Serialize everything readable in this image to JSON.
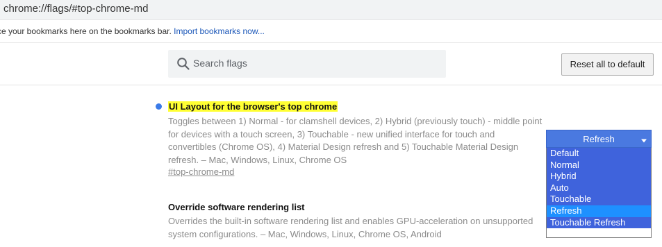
{
  "omnibox": {
    "url": "chrome://flags/#top-chrome-md"
  },
  "bookmarks_bar": {
    "text": "ce your bookmarks here on the bookmarks bar.",
    "import_link": "Import bookmarks now..."
  },
  "header": {
    "search_placeholder": "Search flags",
    "reset_button": "Reset all to default"
  },
  "experiments": [
    {
      "title": "UI Layout for the browser's top chrome",
      "description": "Toggles between 1) Normal - for clamshell devices, 2) Hybrid (previously touch) - middle point for devices with a touch screen, 3) Touchable - new unified interface for touch and convertibles (Chrome OS), 4) Material Design refresh and 5) Touchable Material Design refresh. – Mac, Windows, Linux, Chrome OS",
      "anchor": "#top-chrome-md",
      "select": {
        "value": "Refresh",
        "options": [
          "Default",
          "Normal",
          "Hybrid",
          "Auto",
          "Touchable",
          "Refresh",
          "Touchable Refresh"
        ],
        "selected_option": "Refresh"
      }
    },
    {
      "title": "Override software rendering list",
      "description": "Overrides the built-in software rendering list and enables GPU-acceleration on unsupported system configurations. – Mac, Windows, Linux, Chrome OS, Android"
    }
  ],
  "icons": {
    "search": "search-icon",
    "caret": "chevron-down-icon"
  },
  "colors": {
    "highlight": "#ffff33",
    "select_bg": "#4a79e0",
    "dropdown_bg": "#3f63dc",
    "option_selected": "#1e90ff",
    "link": "#1a56b8",
    "modified_dot": "#3b7be8"
  }
}
